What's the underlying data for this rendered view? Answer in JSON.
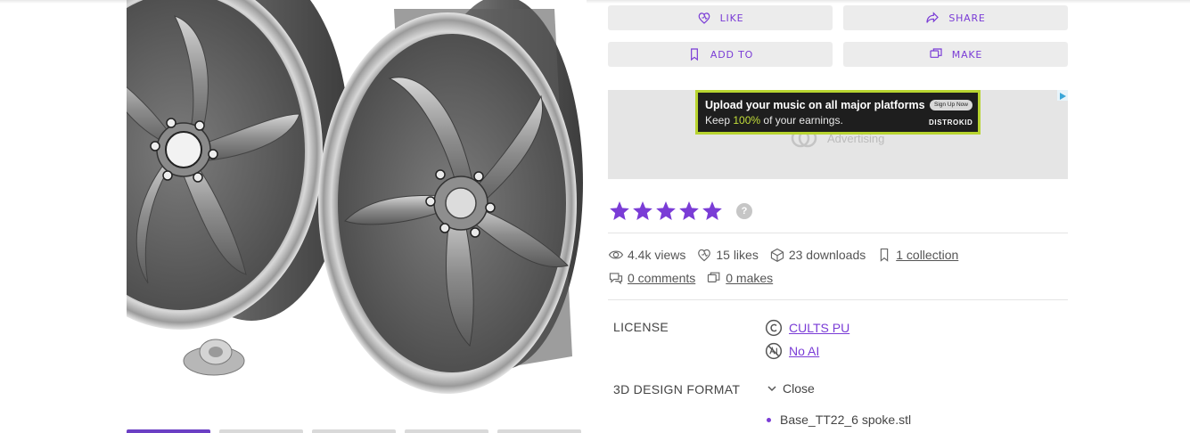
{
  "actions": {
    "like": "LIKE",
    "share": "SHARE",
    "add_to": "ADD TO",
    "make": "MAKE"
  },
  "ad": {
    "placeholder": "Advertising",
    "headline": "Upload your music on all major platforms",
    "line2_prefix": "Keep ",
    "line2_highlight": "100%",
    "line2_suffix": " of your earnings.",
    "cta": "Sign Up Now",
    "brand": "DISTROKID"
  },
  "rating": {
    "stars": 5,
    "help": "?",
    "color": "#7a3cd6"
  },
  "stats": {
    "views": "4.4k views",
    "likes": "15 likes",
    "downloads": "23 downloads",
    "collections": "1 collection",
    "comments": "0 comments",
    "makes": "0 makes"
  },
  "license": {
    "label": "LICENSE",
    "items": [
      "CULTS PU",
      "No AI"
    ]
  },
  "format": {
    "label": "3D DESIGN FORMAT",
    "toggle": "Close",
    "files": [
      "Base_TT22_6 spoke.stl"
    ]
  },
  "colors": {
    "accent": "#7a3cd6",
    "button_bg": "#ececec"
  }
}
